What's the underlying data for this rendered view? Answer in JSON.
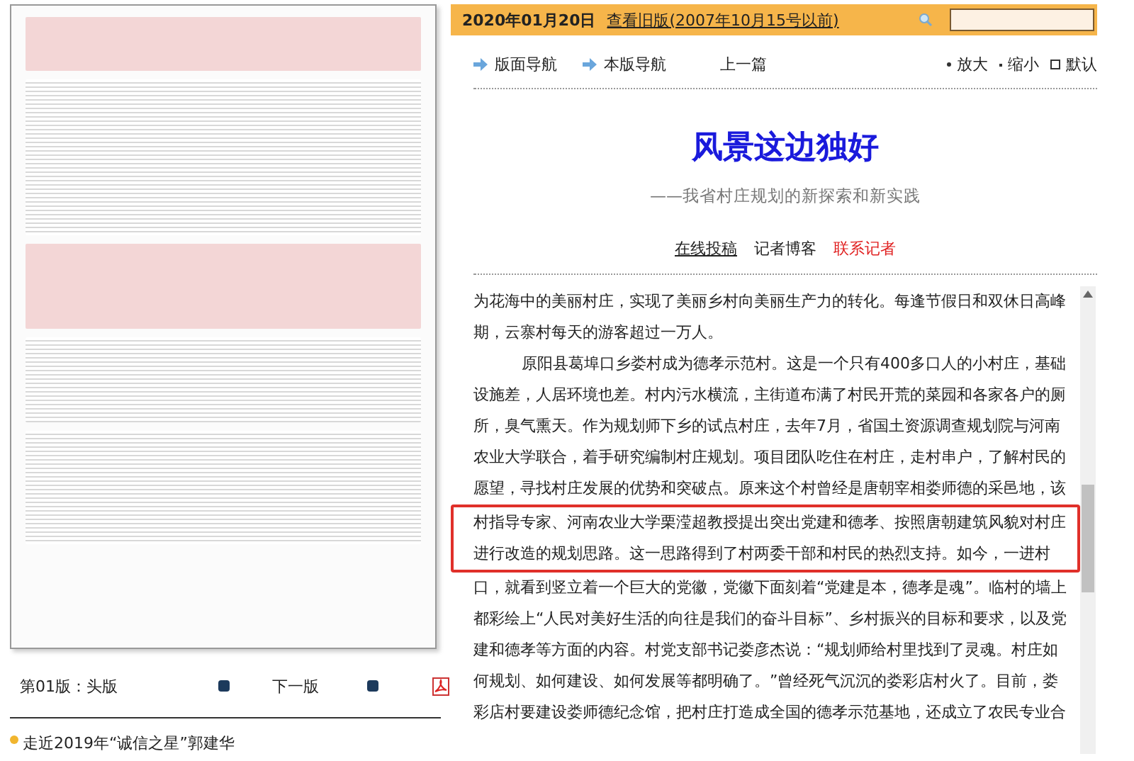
{
  "top_bar": {
    "date": "2020年01月20日",
    "old_version_link": "查看旧版(2007年10月15号以前)"
  },
  "edition": {
    "page_label": "第01版：头版",
    "next_label": "下一版"
  },
  "related": [
    {
      "title": "走近2019年“诚信之星”郭建华"
    }
  ],
  "nav": {
    "items": [
      "版面导航",
      "本版导航"
    ],
    "prev": "上一篇",
    "font_controls": [
      {
        "label": "放大",
        "kind": "larger"
      },
      {
        "label": "缩小",
        "kind": "smaller"
      },
      {
        "label": "默认",
        "kind": "default"
      }
    ]
  },
  "article": {
    "title": "风景这边独好",
    "subtitle": "——我省村庄规划的新探索和新实践",
    "links": [
      {
        "label": "在线投稿",
        "kind": "underlined"
      },
      {
        "label": "记者博客",
        "kind": "plain"
      },
      {
        "label": "联系记者",
        "kind": "red"
      }
    ],
    "paragraphs": [
      {
        "text": "为花海中的美丽村庄，实现了美丽乡村向美丽生产力的转化。每逢节假日和双休日高峰期，云寨村每天的游客超过一万人。",
        "indent": false
      },
      {
        "segments": [
          {
            "text": "原阳县葛埠口乡娄村成为德孝示范村。这是一个只有400多口人的小村庄，基础设施差，人居环境也差。村内污水横流，主街道布满了村民开荒的菜园和各家各户的厕所，臭气熏天。作为规划师下乡的试点村庄，去年7月，省国土资源调查规划院与河南农业大学联合，着手研究编制村庄规划。项目团队吃住在村庄，走村串户，了解村民的愿望，寻找村庄发展的优势和突破点。原来这个村曾经是唐朝宰相娄师德的采邑地，该",
            "highlighted": false
          },
          {
            "text": "村指导专家、河南农业大学栗滢超教授提出突出党建和德孝、按照唐朝建筑风貌对村庄进行改造的规划思路。这一思路得到了村两委干部和村民的热烈支持。如今，一进村",
            "highlighted": true
          },
          {
            "text": "口，就看到竖立着一个巨大的党徽，党徽下面刻着“党建是本，德孝是魂”。临村的墙上都彩绘上“人民对美好生活的向往是我们的奋斗目标”、乡村振兴的目标和要求，以及党建和德孝等方面的内容。村党支部书记娄彦杰说：“规划师给村里找到了灵魂。村庄如何规划、如何建设、如何发展等都明确了。”曾经死气沉沉的娄彩店村火了。目前，娄彩店村要建设娄师德纪念馆，把村庄打造成全国的德孝示范基地，还成立了农民专业合",
            "highlighted": false
          }
        ],
        "indent": true
      }
    ]
  }
}
